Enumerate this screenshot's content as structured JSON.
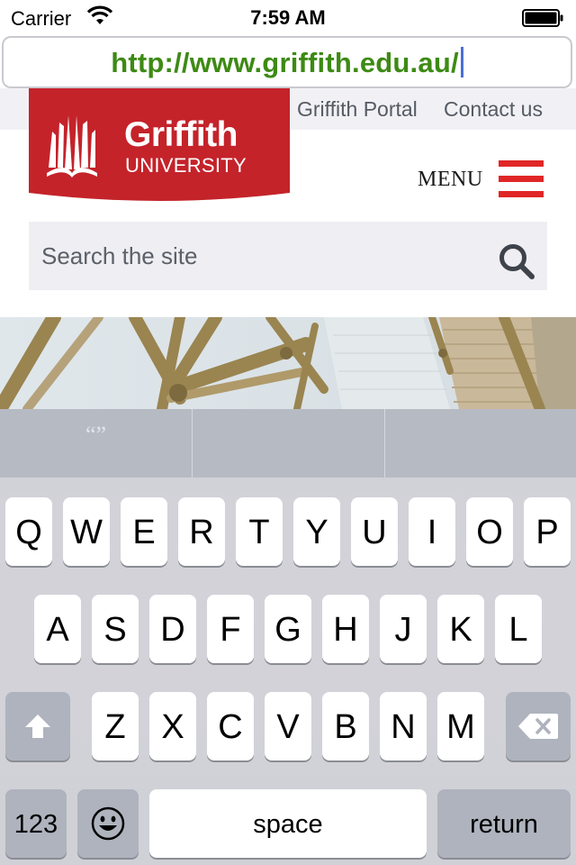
{
  "status_bar": {
    "carrier": "Carrier",
    "time": "7:59 AM"
  },
  "browser": {
    "url": "http://www.griffith.edu.au/"
  },
  "header": {
    "links": [
      "Griffith Portal",
      "Contact us"
    ],
    "logo": {
      "name": "Griffith",
      "sub": "UNIVERSITY"
    },
    "menu_label": "MENU"
  },
  "search": {
    "placeholder": "Search the site"
  },
  "keyboard": {
    "suggestion": "“”",
    "row1": [
      "Q",
      "W",
      "E",
      "R",
      "T",
      "Y",
      "U",
      "I",
      "O",
      "P"
    ],
    "row2": [
      "A",
      "S",
      "D",
      "F",
      "G",
      "H",
      "J",
      "K",
      "L"
    ],
    "row3": [
      "Z",
      "X",
      "C",
      "V",
      "B",
      "N",
      "M"
    ],
    "numbers_label": "123",
    "space_label": "space",
    "return_label": "return"
  },
  "colors": {
    "url": "#3d8a14",
    "brand_red": "#c4232a",
    "menu_red": "#e02626"
  }
}
